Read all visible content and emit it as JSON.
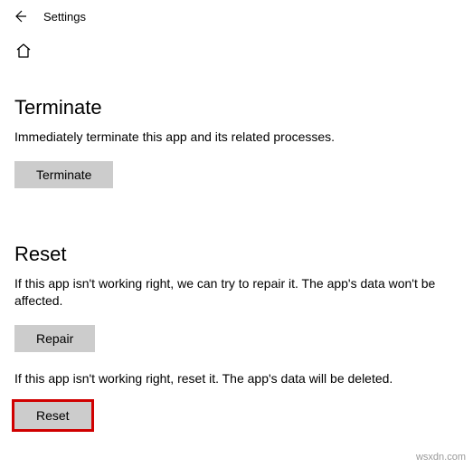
{
  "header": {
    "title": "Settings"
  },
  "sections": {
    "terminate": {
      "heading": "Terminate",
      "description": "Immediately terminate this app and its related processes.",
      "button_label": "Terminate"
    },
    "reset": {
      "heading": "Reset",
      "repair_description": "If this app isn't working right, we can try to repair it. The app's data won't be affected.",
      "repair_button_label": "Repair",
      "reset_description": "If this app isn't working right, reset it. The app's data will be deleted.",
      "reset_button_label": "Reset"
    }
  },
  "watermark": "wsxdn.com"
}
